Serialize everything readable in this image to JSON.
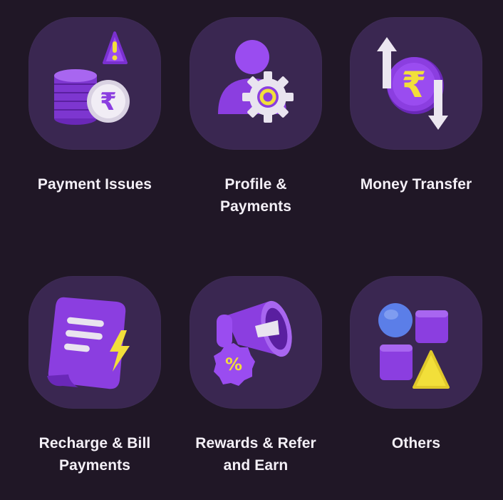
{
  "theme": {
    "background": "#201726",
    "tile": "#3a2751",
    "purple": "#8b3ee0",
    "purple_dark": "#6a28b8",
    "purple_light": "#a866f0",
    "yellow": "#f2df3a",
    "white": "#eeeaf2",
    "blue": "#5b7ee8",
    "label_color": "#f4f0f7"
  },
  "categories": [
    {
      "icon": "coins-warning-icon",
      "line1": "Payment Issues",
      "line2": ""
    },
    {
      "icon": "profile-gear-icon",
      "line1": "Profile &",
      "line2": "Payments"
    },
    {
      "icon": "rupee-transfer-icon",
      "line1": "Money Transfer",
      "line2": ""
    },
    {
      "icon": "bill-receipt-icon",
      "line1": "Recharge & Bill",
      "line2": "Payments"
    },
    {
      "icon": "megaphone-offer-icon",
      "line1": "Rewards & Refer",
      "line2": "and Earn"
    },
    {
      "icon": "shapes-icon",
      "line1": "Others",
      "line2": ""
    }
  ]
}
